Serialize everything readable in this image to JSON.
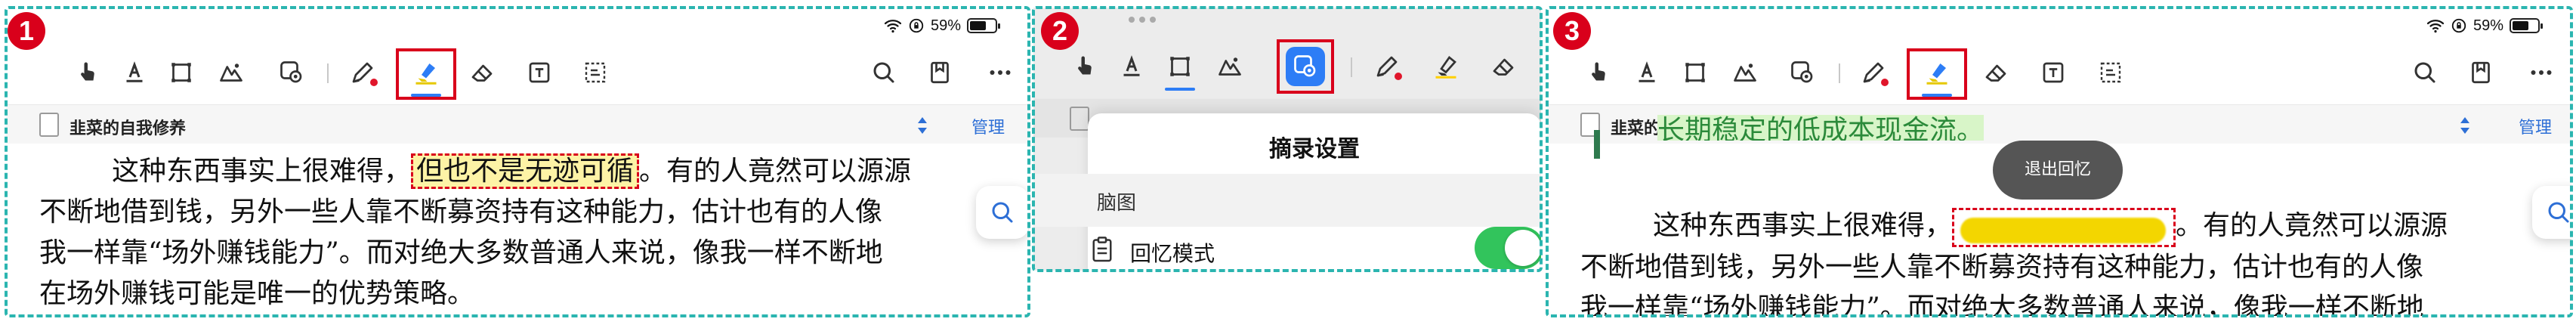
{
  "status": {
    "battery": "59%"
  },
  "document": {
    "title": "韭菜的自我修养",
    "manage_label": "管理"
  },
  "panel1": {
    "badge": "1",
    "article": {
      "line1_before": "这种东西事实上很难得，",
      "line1_highlight": "但也不是无迹可循",
      "line1_after": "。有的人竟然可以源源",
      "line2": "不断地借到钱，另外一些人靠不断募资持有这种能力，估计也有的人像",
      "line3": "我一样靠“场外赚钱能力”。而对绝大多数普通人来说，像我一样不断地",
      "line4": "在场外赚钱可能是唯一的优势策略。"
    }
  },
  "panel2": {
    "badge": "2",
    "sheet": {
      "title": "摘录设置",
      "section": "脑图",
      "row_label": "回忆模式",
      "toggle_on": true
    }
  },
  "panel3": {
    "badge": "3",
    "top_line": "长期稳定的低成本现金流。",
    "toast": "退出回忆",
    "article": {
      "line1_before": "这种东西事实上很难得，",
      "line1_after": "。有的人竟然可以源源",
      "line2": "不断地借到钱，另外一些人靠不断募资持有这种能力，估计也有的人像",
      "line3": "我一样靠“场外赚钱能力”。而对绝大多数普通人来说，像我一样不断地"
    }
  },
  "colors": {
    "accent": "#2d7df6",
    "frame": "#2bb5b0",
    "callout": "#d9001b",
    "highlight": "#fdf3a6",
    "recall": "#f3d600",
    "toggle": "#32c45c"
  },
  "icons": {
    "toolbar": [
      "hand-pointer-icon",
      "text-underline-icon",
      "rect-select-icon",
      "image-mountain-icon",
      "settings-gear-icon",
      "pen-icon",
      "highlighter-icon",
      "eraser-icon",
      "text-box-icon",
      "lasso-icon",
      "search-icon",
      "bookmark-icon",
      "more-icon"
    ]
  }
}
